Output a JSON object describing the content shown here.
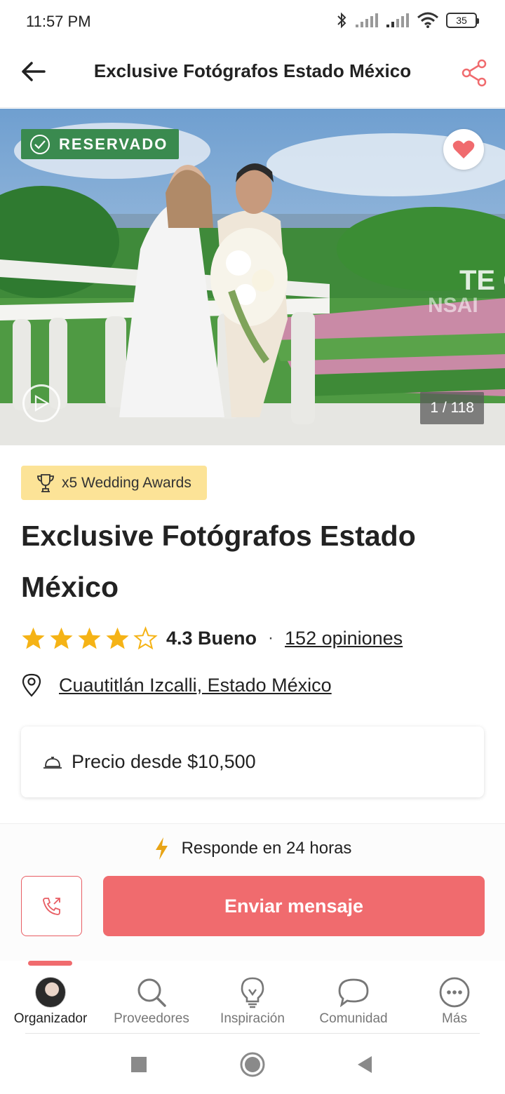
{
  "status_bar": {
    "time": "11:57 PM",
    "battery": "35"
  },
  "header": {
    "title": "Exclusive Fotógrafos Estado México"
  },
  "hero": {
    "badge": "RESERVADO",
    "counter": "1 / 118",
    "watermark": "TE Q NSAI"
  },
  "awards": {
    "label": "x5 Wedding Awards"
  },
  "vendor": {
    "title": "Exclusive Fotógrafos Estado México",
    "rating_value": 4.3,
    "rating_text": "4.3 Bueno",
    "stars_filled": 4,
    "stars_total": 5,
    "reviews_link": "152 opiniones",
    "location": "Cuautitlán Izcalli, Estado México"
  },
  "price": {
    "label": "Precio desde $10,500"
  },
  "actions": {
    "response_time": "Responde en 24 horas",
    "send_label": "Enviar mensaje"
  },
  "bottom_nav": {
    "items": [
      {
        "label": "Organizador",
        "icon": "avatar"
      },
      {
        "label": "Proveedores",
        "icon": "search-icon"
      },
      {
        "label": "Inspiración",
        "icon": "lightbulb-icon"
      },
      {
        "label": "Comunidad",
        "icon": "chat-bubble-icon"
      },
      {
        "label": "Más",
        "icon": "more-icon"
      }
    ],
    "active_index": 0
  },
  "colors": {
    "brand": "#f06b6e",
    "reserved_green": "#3a8a4f",
    "award_yellow": "#fce397",
    "star": "#f5b316"
  }
}
